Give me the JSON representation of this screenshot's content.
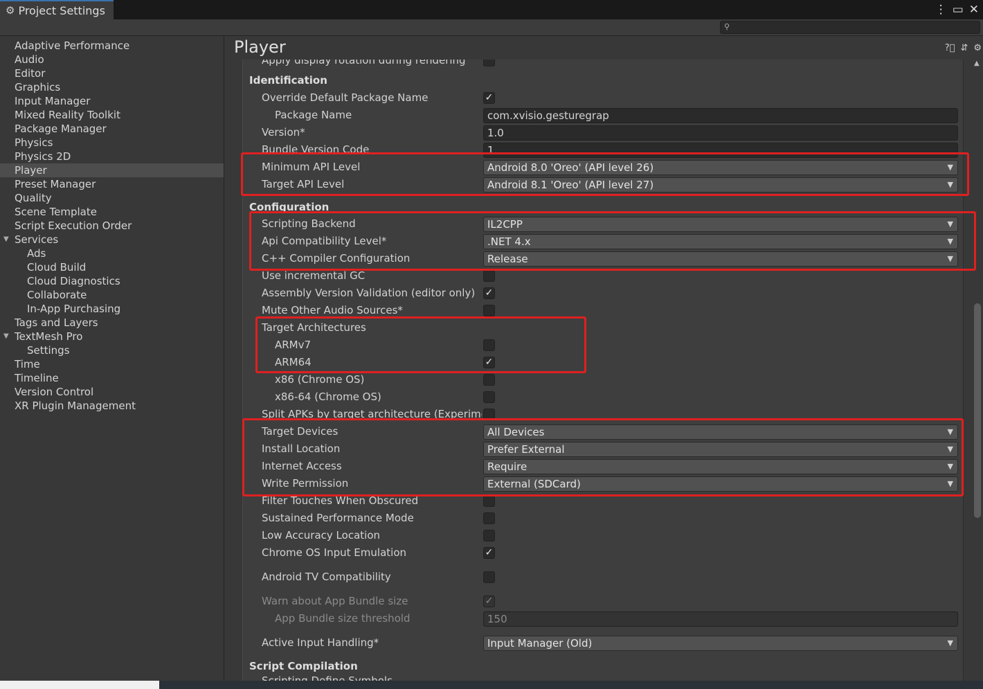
{
  "window": {
    "tab_title": "Project Settings",
    "search_placeholder": ""
  },
  "sidebar": {
    "items": [
      {
        "label": "Adaptive Performance",
        "indent": 0
      },
      {
        "label": "Audio",
        "indent": 0
      },
      {
        "label": "Editor",
        "indent": 0
      },
      {
        "label": "Graphics",
        "indent": 0
      },
      {
        "label": "Input Manager",
        "indent": 0
      },
      {
        "label": "Mixed Reality Toolkit",
        "indent": 0
      },
      {
        "label": "Package Manager",
        "indent": 0
      },
      {
        "label": "Physics",
        "indent": 0
      },
      {
        "label": "Physics 2D",
        "indent": 0
      },
      {
        "label": "Player",
        "indent": 0,
        "selected": true
      },
      {
        "label": "Preset Manager",
        "indent": 0
      },
      {
        "label": "Quality",
        "indent": 0
      },
      {
        "label": "Scene Template",
        "indent": 0
      },
      {
        "label": "Script Execution Order",
        "indent": 0
      },
      {
        "label": "Services",
        "indent": 0,
        "foldout": true
      },
      {
        "label": "Ads",
        "indent": 1
      },
      {
        "label": "Cloud Build",
        "indent": 1
      },
      {
        "label": "Cloud Diagnostics",
        "indent": 1
      },
      {
        "label": "Collaborate",
        "indent": 1
      },
      {
        "label": "In-App Purchasing",
        "indent": 1
      },
      {
        "label": "Tags and Layers",
        "indent": 0
      },
      {
        "label": "TextMesh Pro",
        "indent": 0,
        "foldout": true
      },
      {
        "label": "Settings",
        "indent": 1
      },
      {
        "label": "Time",
        "indent": 0
      },
      {
        "label": "Timeline",
        "indent": 0
      },
      {
        "label": "Version Control",
        "indent": 0
      },
      {
        "label": "XR Plugin Management",
        "indent": 0
      }
    ]
  },
  "main": {
    "title": "Player",
    "rows": [
      {
        "label": "Apply display rotation during rendering",
        "kind": "checkbox",
        "checked": false,
        "indent": 1
      },
      {
        "label": "Identification",
        "kind": "header"
      },
      {
        "label": "Override Default Package Name",
        "kind": "checkbox",
        "checked": true,
        "indent": 1
      },
      {
        "label": "Package Name",
        "kind": "text",
        "value": "com.xvisio.gesturegrap",
        "indent": 2
      },
      {
        "label": "Version*",
        "kind": "text",
        "value": "1.0",
        "indent": 1
      },
      {
        "label": "Bundle Version Code",
        "kind": "text",
        "value": "1",
        "indent": 1
      },
      {
        "label": "Minimum API Level",
        "kind": "dropdown",
        "value": "Android 8.0 'Oreo' (API level 26)",
        "indent": 1
      },
      {
        "label": "Target API Level",
        "kind": "dropdown",
        "value": "Android 8.1 'Oreo' (API level 27)",
        "indent": 1
      },
      {
        "label": "Configuration",
        "kind": "header"
      },
      {
        "label": "Scripting Backend",
        "kind": "dropdown",
        "value": "IL2CPP",
        "indent": 1
      },
      {
        "label": "Api Compatibility Level*",
        "kind": "dropdown",
        "value": ".NET 4.x",
        "indent": 1
      },
      {
        "label": "C++ Compiler Configuration",
        "kind": "dropdown",
        "value": "Release",
        "indent": 1
      },
      {
        "label": "Use incremental GC",
        "kind": "checkbox",
        "checked": false,
        "indent": 1
      },
      {
        "label": "Assembly Version Validation (editor only)",
        "kind": "checkbox",
        "checked": true,
        "indent": 1
      },
      {
        "label": "Mute Other Audio Sources*",
        "kind": "checkbox",
        "checked": false,
        "indent": 1
      },
      {
        "label": "Target Architectures",
        "kind": "label",
        "indent": 1
      },
      {
        "label": "ARMv7",
        "kind": "checkbox",
        "checked": false,
        "indent": 2
      },
      {
        "label": "ARM64",
        "kind": "checkbox",
        "checked": true,
        "indent": 2
      },
      {
        "label": "x86 (Chrome OS)",
        "kind": "checkbox",
        "checked": false,
        "indent": 2
      },
      {
        "label": "x86-64 (Chrome OS)",
        "kind": "checkbox",
        "checked": false,
        "indent": 2
      },
      {
        "label": "Split APKs by target architecture (Experimen",
        "kind": "checkbox",
        "checked": false,
        "indent": 1
      },
      {
        "label": "Target Devices",
        "kind": "dropdown",
        "value": "All Devices",
        "indent": 1
      },
      {
        "label": "Install Location",
        "kind": "dropdown",
        "value": "Prefer External",
        "indent": 1
      },
      {
        "label": "Internet Access",
        "kind": "dropdown",
        "value": "Require",
        "indent": 1
      },
      {
        "label": "Write Permission",
        "kind": "dropdown",
        "value": "External (SDCard)",
        "indent": 1
      },
      {
        "label": "Filter Touches When Obscured",
        "kind": "checkbox",
        "checked": false,
        "indent": 1
      },
      {
        "label": "Sustained Performance Mode",
        "kind": "checkbox",
        "checked": false,
        "indent": 1
      },
      {
        "label": "Low Accuracy Location",
        "kind": "checkbox",
        "checked": false,
        "indent": 1
      },
      {
        "label": "Chrome OS Input Emulation",
        "kind": "checkbox",
        "checked": true,
        "indent": 1
      },
      {
        "label": "Android TV Compatibility",
        "kind": "checkbox",
        "checked": false,
        "indent": 1
      },
      {
        "label": "Warn about App Bundle size",
        "kind": "checkbox",
        "checked": true,
        "indent": 1,
        "disabled": true
      },
      {
        "label": "App Bundle size threshold",
        "kind": "text",
        "value": "150",
        "indent": 2,
        "disabled": true
      },
      {
        "label": "Active Input Handling*",
        "kind": "dropdown",
        "value": "Input Manager (Old)",
        "indent": 1
      },
      {
        "label": "Script Compilation",
        "kind": "header"
      },
      {
        "label": "Scripting Define Symbols",
        "kind": "label",
        "indent": 1
      }
    ]
  },
  "icons": {
    "settings": "gear-icon",
    "menu": "kebab-menu-icon",
    "maximize": "maximize-icon",
    "close": "close-icon",
    "search": "search-icon",
    "help": "help-icon",
    "preset": "preset-icon",
    "options": "gear-icon"
  },
  "colors": {
    "annotation": "#e02020",
    "selection": "#4d4d4d",
    "background": "#383838"
  }
}
